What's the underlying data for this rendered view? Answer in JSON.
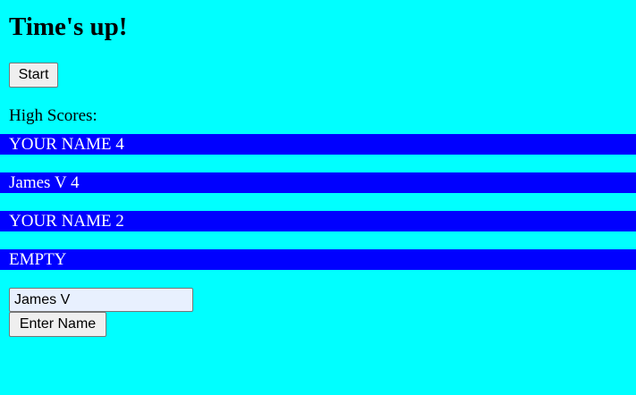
{
  "header": {
    "title": "Time's up!"
  },
  "controls": {
    "start_label": "Start"
  },
  "high_scores": {
    "label": "High Scores:",
    "entries": [
      "YOUR NAME 4",
      "James V 4",
      "YOUR NAME 2",
      "EMPTY"
    ]
  },
  "name_entry": {
    "input_value": "James V",
    "submit_label": "Enter Name"
  },
  "colors": {
    "background": "#00ffff",
    "score_row_bg": "#0000ff",
    "score_row_text": "#ffffff",
    "input_bg": "#e8f0fe"
  }
}
